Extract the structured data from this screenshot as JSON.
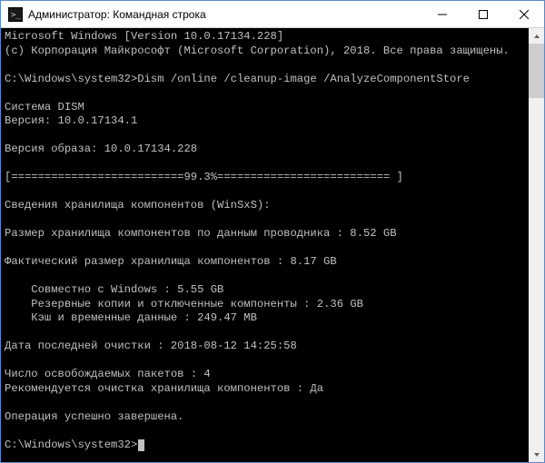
{
  "titlebar": {
    "title": "Администратор: Командная строка"
  },
  "console": {
    "header_line1": "Microsoft Windows [Version 10.0.17134.228]",
    "header_line2": "(c) Корпорация Майкрософт (Microsoft Corporation), 2018. Все права защищены.",
    "prompt1_path": "C:\\Windows\\system32>",
    "prompt1_cmd": "Dism /online /cleanup-image /AnalyzeComponentStore",
    "dism_system": "Cистема DISM",
    "dism_version": "Версия: 10.0.17134.1",
    "image_version": "Версия образа: 10.0.17134.228",
    "progress_line": "[==========================99.3%========================== ]",
    "winsxs_header": "Сведения хранилища компонентов (WinSxS):",
    "explorer_size": "Размер хранилища компонентов по данным проводника : 8.52 GB",
    "actual_size": "Фактический размер хранилища компонентов : 8.17 GB",
    "shared_with_windows": "    Совместно с Windows : 5.55 GB",
    "backups_disabled": "    Резервные копии и отключенные компоненты : 2.36 GB",
    "cache_temp": "    Кэш и временные данные : 249.47 MB",
    "last_cleanup": "Дата последней очистки : 2018-08-12 14:25:58",
    "reclaimable": "Число освобождаемых пакетов : 4",
    "cleanup_recommended": "Рекомендуется очистка хранилища компонентов : Да",
    "operation_done": "Операция успешно завершена.",
    "prompt2_path": "C:\\Windows\\system32>"
  }
}
